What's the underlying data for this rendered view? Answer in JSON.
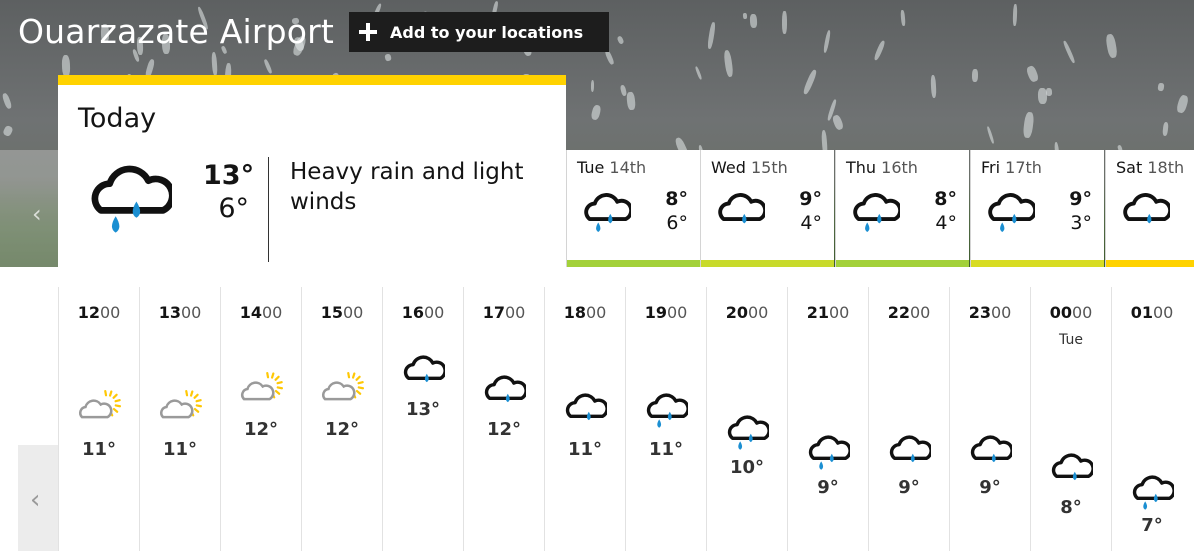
{
  "location": {
    "name": "Ouarzazate Airport"
  },
  "actions": {
    "add_location_label": "Add to your locations"
  },
  "today": {
    "label": "Today",
    "high": "13°",
    "low": "6°",
    "description": "Heavy rain and light winds",
    "icon": "heavy-rain-icon"
  },
  "days": [
    {
      "day": "Tue",
      "date": "14th",
      "high": "8°",
      "low": "6°",
      "icon": "heavy-rain-icon",
      "bar_color": "#a3d13a"
    },
    {
      "day": "Wed",
      "date": "15th",
      "high": "9°",
      "low": "4°",
      "icon": "light-rain-icon",
      "bar_color": "#c8da2b"
    },
    {
      "day": "Thu",
      "date": "16th",
      "high": "8°",
      "low": "4°",
      "icon": "heavy-rain-icon",
      "bar_color": "#a3d13a"
    },
    {
      "day": "Fri",
      "date": "17th",
      "high": "9°",
      "low": "3°",
      "icon": "heavy-rain-icon",
      "bar_color": "#d8dc22"
    },
    {
      "day": "Sat",
      "date": "18th",
      "high": "",
      "low": "",
      "icon": "light-rain-icon",
      "bar_color": "#ffd200"
    }
  ],
  "hours": [
    {
      "hh": "12",
      "mm": "00",
      "sub": "",
      "temp": "11°",
      "icon": "sunny-cloud-icon"
    },
    {
      "hh": "13",
      "mm": "00",
      "sub": "",
      "temp": "11°",
      "icon": "sunny-cloud-icon"
    },
    {
      "hh": "14",
      "mm": "00",
      "sub": "",
      "temp": "12°",
      "icon": "sunny-cloud-icon"
    },
    {
      "hh": "15",
      "mm": "00",
      "sub": "",
      "temp": "12°",
      "icon": "sunny-cloud-icon"
    },
    {
      "hh": "16",
      "mm": "00",
      "sub": "",
      "temp": "13°",
      "icon": "light-rain-icon"
    },
    {
      "hh": "17",
      "mm": "00",
      "sub": "",
      "temp": "12°",
      "icon": "light-rain-icon"
    },
    {
      "hh": "18",
      "mm": "00",
      "sub": "",
      "temp": "11°",
      "icon": "light-rain-icon"
    },
    {
      "hh": "19",
      "mm": "00",
      "sub": "",
      "temp": "11°",
      "icon": "heavy-rain-icon"
    },
    {
      "hh": "20",
      "mm": "00",
      "sub": "",
      "temp": "10°",
      "icon": "heavy-rain-icon"
    },
    {
      "hh": "21",
      "mm": "00",
      "sub": "",
      "temp": "9°",
      "icon": "heavy-rain-icon"
    },
    {
      "hh": "22",
      "mm": "00",
      "sub": "",
      "temp": "9°",
      "icon": "light-rain-icon"
    },
    {
      "hh": "23",
      "mm": "00",
      "sub": "",
      "temp": "9°",
      "icon": "light-rain-icon"
    },
    {
      "hh": "00",
      "mm": "00",
      "sub": "Tue",
      "temp": "8°",
      "icon": "light-rain-icon"
    },
    {
      "hh": "01",
      "mm": "00",
      "sub": "",
      "temp": "7°",
      "icon": "heavy-rain-icon"
    }
  ],
  "colors": {
    "today_accent": "#ffd200",
    "rain_drop": "#1b8fd2",
    "sun": "#ffc805",
    "cloud_light": "#9a9a9a"
  }
}
